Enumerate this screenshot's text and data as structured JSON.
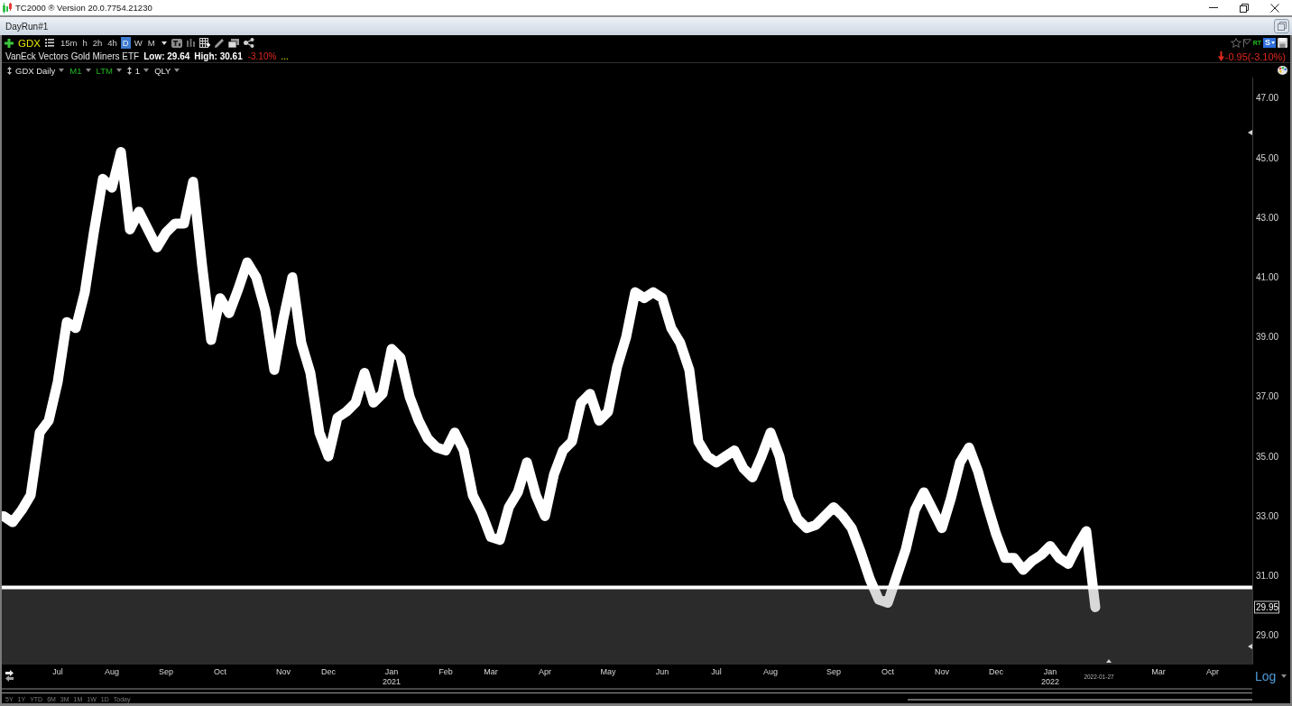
{
  "title_bar": {
    "title": "TC2000 ® Version 20.0.7754.21230"
  },
  "workspace_tab": {
    "label": "DayRun#1"
  },
  "toolbar": {
    "symbol": "GDX",
    "timeframes": [
      {
        "label": "15m",
        "selected": false
      },
      {
        "label": "h",
        "selected": false
      },
      {
        "label": "2h",
        "selected": false
      },
      {
        "label": "4h",
        "selected": false
      },
      {
        "label": "D",
        "selected": true
      },
      {
        "label": "W",
        "selected": false
      },
      {
        "label": "M",
        "selected": false
      }
    ],
    "rt_label": "RT",
    "s_label": "S"
  },
  "quote": {
    "name": "VanEck Vectors Gold Miners ETF",
    "low": "Low: 29.64",
    "high": "High: 30.61",
    "change_pct": "-3.10%",
    "more": "...",
    "negative": true,
    "net_change": "-0.95(-3.10%)"
  },
  "chart_header": {
    "items": [
      {
        "kind": "handle",
        "label": "GDX Daily",
        "active": false
      },
      {
        "kind": "plain",
        "label": "M1",
        "active": true
      },
      {
        "kind": "plain",
        "label": "LTM",
        "active": true
      },
      {
        "kind": "handle",
        "label": "1",
        "active": false
      },
      {
        "kind": "plain",
        "label": "QLY",
        "active": false
      }
    ]
  },
  "chart": {
    "chart_data": {
      "type": "line",
      "categories": [
        null,
        null,
        null,
        null,
        null,
        null,
        "Jul",
        null,
        null,
        null,
        null,
        null,
        "Aug",
        null,
        null,
        null,
        null,
        null,
        "Sep",
        null,
        null,
        null,
        null,
        null,
        "Oct",
        null,
        null,
        null,
        null,
        null,
        null,
        "Nov",
        null,
        null,
        null,
        null,
        "Dec",
        null,
        null,
        null,
        null,
        null,
        null,
        "Jan",
        null,
        null,
        null,
        null,
        null,
        "Feb",
        null,
        null,
        null,
        null,
        "Mar",
        null,
        null,
        null,
        null,
        null,
        "Apr",
        null,
        null,
        null,
        null,
        null,
        null,
        "May",
        null,
        null,
        null,
        null,
        null,
        "Jun",
        null,
        null,
        null,
        null,
        null,
        "Jul",
        null,
        null,
        null,
        null,
        null,
        "Aug",
        null,
        null,
        null,
        null,
        null,
        null,
        "Sep",
        null,
        null,
        null,
        null,
        null,
        "Oct",
        null,
        null,
        null,
        null,
        null,
        "Nov",
        null,
        null,
        null,
        null,
        null,
        "Dec",
        null,
        null,
        null,
        null,
        null,
        "Jan",
        null,
        null,
        null,
        null,
        null,
        null,
        null,
        null,
        null,
        null,
        null,
        "Mar",
        null,
        null,
        null,
        null,
        null,
        "Apr",
        null,
        null,
        null,
        null
      ],
      "ylim": [
        28.03,
        47.69
      ],
      "yticks": [
        {
          "value": 29,
          "label": "29.00"
        },
        {
          "value": 31,
          "label": "31.00"
        },
        {
          "value": 33,
          "label": "33.00"
        },
        {
          "value": 35,
          "label": "35.00"
        },
        {
          "value": 37,
          "label": "37.00"
        },
        {
          "value": 39,
          "label": "39.00"
        },
        {
          "value": 41,
          "label": "41.00"
        },
        {
          "value": 43,
          "label": "43.00"
        },
        {
          "value": 45,
          "label": "45.00"
        },
        {
          "value": 47,
          "label": "47.00"
        }
      ],
      "series": [
        {
          "color": "#ffffff",
          "values": [
            33.0,
            32.8,
            33.2,
            33.7,
            35.8,
            36.2,
            37.5,
            39.5,
            39.3,
            40.5,
            42.5,
            44.3,
            44.0,
            45.2,
            42.6,
            43.2,
            42.6,
            42.0,
            42.5,
            42.8,
            42.8,
            44.2,
            41.4,
            38.9,
            40.3,
            39.8,
            40.6,
            41.5,
            41.0,
            39.9,
            37.9,
            39.6,
            41.0,
            38.8,
            37.8,
            35.8,
            35.0,
            36.3,
            36.5,
            36.8,
            37.8,
            36.8,
            37.1,
            38.6,
            38.3,
            37.0,
            36.2,
            35.6,
            35.3,
            35.2,
            35.8,
            35.2,
            33.7,
            33.1,
            32.3,
            32.2,
            33.3,
            33.8,
            34.8,
            33.7,
            33.0,
            34.4,
            35.2,
            35.5,
            36.8,
            37.1,
            36.2,
            36.5,
            38.0,
            39.0,
            40.5,
            40.3,
            40.5,
            40.3,
            39.3,
            38.8,
            37.9,
            35.5,
            35.0,
            34.8,
            35.0,
            35.2,
            34.6,
            34.3,
            35.0,
            35.8,
            35.0,
            33.6,
            32.9,
            32.6,
            32.7,
            33.0,
            33.3,
            33.0,
            32.6,
            31.8,
            30.9,
            30.2,
            30.1,
            31.0,
            31.9,
            33.2,
            33.8,
            33.2,
            32.6,
            33.6,
            34.8,
            35.3,
            34.5,
            33.4,
            32.4,
            31.6,
            31.6,
            31.2,
            31.5,
            31.7,
            32.0,
            31.6,
            31.4,
            32.0,
            32.5,
            29.95,
            null,
            null,
            null,
            null,
            null,
            null,
            null,
            null,
            null,
            null,
            null,
            null,
            null,
            null,
            null,
            null,
            null
          ]
        }
      ],
      "ref_lines": [
        {
          "axis": "y",
          "value": 30.61
        }
      ]
    },
    "last_price": "29.95",
    "cursor_date": "2022-01-27",
    "year_labels": [
      "2021",
      "2022"
    ],
    "scale_mode": "Log"
  },
  "range_buttons": [
    "5Y",
    "1Y",
    "YTD",
    "6M",
    "3M",
    "1M",
    "1W",
    "1D",
    "Today"
  ]
}
